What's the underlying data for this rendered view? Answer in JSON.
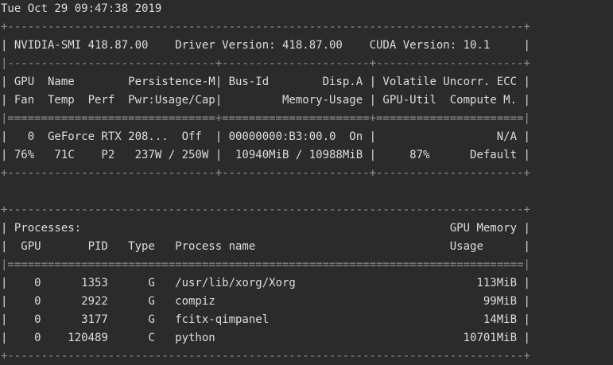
{
  "window": {
    "type": "terminal",
    "background": "#2b2b2b",
    "foreground": "#d8dee3"
  },
  "terminal": {
    "lines": [
      "Tue Oct 29 09:47:38 2019",
      "+-----------------------------------------------------------------------------+",
      "| NVIDIA-SMI 418.87.00    Driver Version: 418.87.00    CUDA Version: 10.1     |",
      "|-------------------------------+----------------------+----------------------+",
      "| GPU  Name        Persistence-M| Bus-Id        Disp.A | Volatile Uncorr. ECC |",
      "| Fan  Temp  Perf  Pwr:Usage/Cap|         Memory-Usage | GPU-Util  Compute M. |",
      "|===============================+======================+======================|",
      "|   0  GeForce RTX 208...  Off  | 00000000:B3:00.0  On |                  N/A |",
      "| 76%   71C    P2   237W / 250W |  10940MiB / 10988MiB |     87%      Default |",
      "+-------------------------------+----------------------+----------------------+",
      "",
      "+-----------------------------------------------------------------------------+",
      "| Processes:                                                       GPU Memory |",
      "|  GPU       PID   Type   Process name                             Usage      |",
      "|=============================================================================|",
      "|    0      1353      G   /usr/lib/xorg/Xorg                           113MiB |",
      "|    0      2922      G   compiz                                        99MiB |",
      "|    0      3177      G   fcitx-qimpanel                                14MiB |",
      "|    0    120489      C   python                                     10701MiB |",
      "+-----------------------------------------------------------------------------+"
    ]
  },
  "smi": {
    "timestamp": "Tue Oct 29 09:47:38 2019",
    "nvidia_smi_version": "418.87.00",
    "driver_version": "418.87.00",
    "cuda_version": "10.1",
    "gpus": [
      {
        "index": "0",
        "name": "GeForce RTX 208...",
        "persistence_mode": "Off",
        "bus_id": "00000000:B3:00.0",
        "display_active": "On",
        "volatile_uncorr_ecc": "N/A",
        "fan": "76%",
        "temp": "71C",
        "perf": "P2",
        "power_usage": "237W",
        "power_cap": "250W",
        "memory_used": "10940MiB",
        "memory_total": "10988MiB",
        "gpu_util": "87%",
        "compute_mode": "Default"
      }
    ],
    "processes": [
      {
        "gpu": "0",
        "pid": "1353",
        "type": "G",
        "name": "/usr/lib/xorg/Xorg",
        "memory": "113MiB"
      },
      {
        "gpu": "0",
        "pid": "2922",
        "type": "G",
        "name": "compiz",
        "memory": "99MiB"
      },
      {
        "gpu": "0",
        "pid": "3177",
        "type": "G",
        "name": "fcitx-qimpanel",
        "memory": "14MiB"
      },
      {
        "gpu": "0",
        "pid": "120489",
        "type": "C",
        "name": "python",
        "memory": "10701MiB"
      }
    ]
  }
}
